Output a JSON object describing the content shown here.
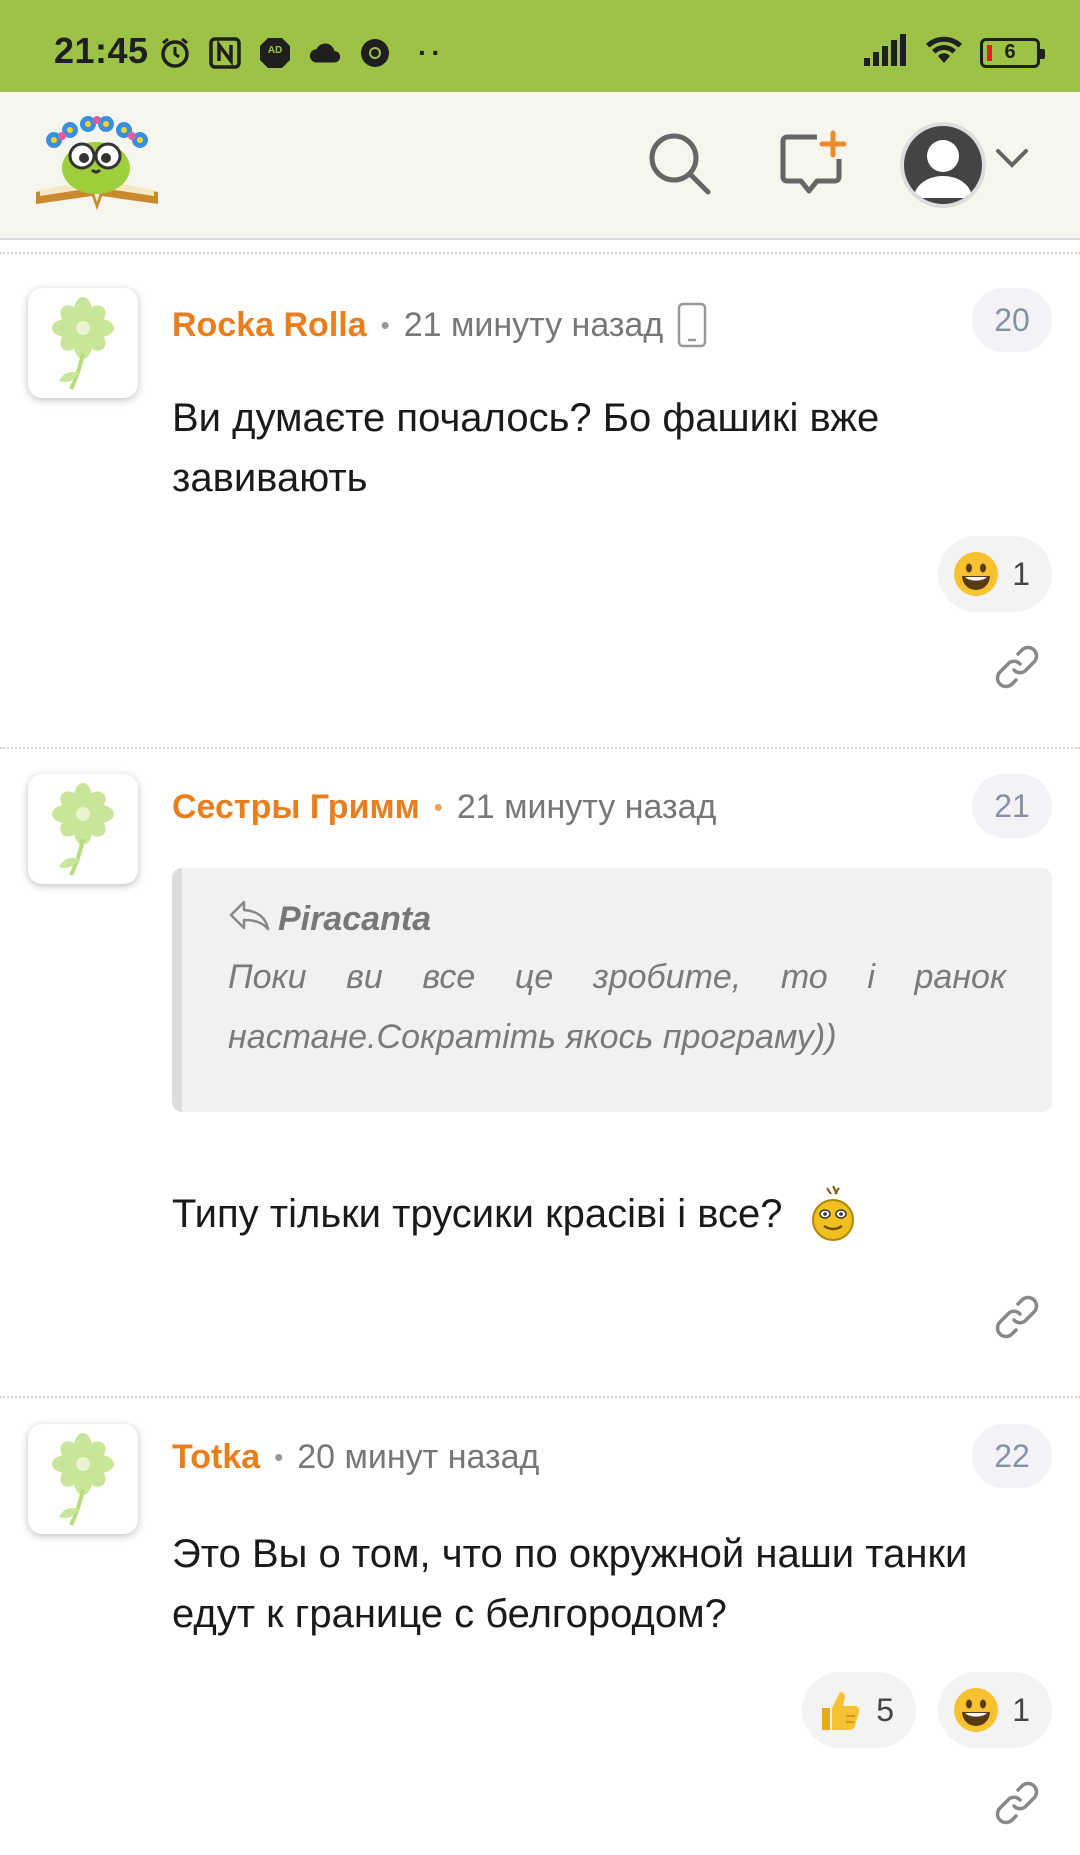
{
  "status": {
    "time": "21:45",
    "battery": "6",
    "adblock_label": "AD"
  },
  "header": {
    "search_icon": "search-icon",
    "new_comment_icon": "chat-add-icon",
    "profile_icon": "user-avatar-icon",
    "menu_icon": "chevron-down-icon"
  },
  "comments": [
    {
      "author": "Rocka Rolla",
      "time": "21 минуту назад",
      "number": "20",
      "text_line1": "Ви думаєте почалось? Бо фашикі вже",
      "text_line2": "завивають",
      "reactions": [
        {
          "emoji": "grinning-face",
          "count": "1"
        }
      ]
    },
    {
      "author": "Сестры Гримм",
      "time": "21 минуту назад",
      "number": "21",
      "quote_author": "Piracanta",
      "quote_line1": "Поки ви все це зробите, то і ранок",
      "quote_line2": "настане.Сократіть якось програму))",
      "text": "Типу тільки трусики красіві і все?"
    },
    {
      "author": "Totka",
      "time": "20 минут назад",
      "number": "22",
      "text_line1": "Это Вы о том, что по окружной наши танки",
      "text_line2": "едут к границе с белгородом?",
      "reactions": [
        {
          "emoji": "thumbs-up",
          "count": "5"
        },
        {
          "emoji": "grinning-face",
          "count": "1"
        }
      ]
    }
  ],
  "colors": {
    "status_bar": "#9dc346",
    "author": "#e87e1c",
    "header_bg": "#f6f6ee"
  }
}
